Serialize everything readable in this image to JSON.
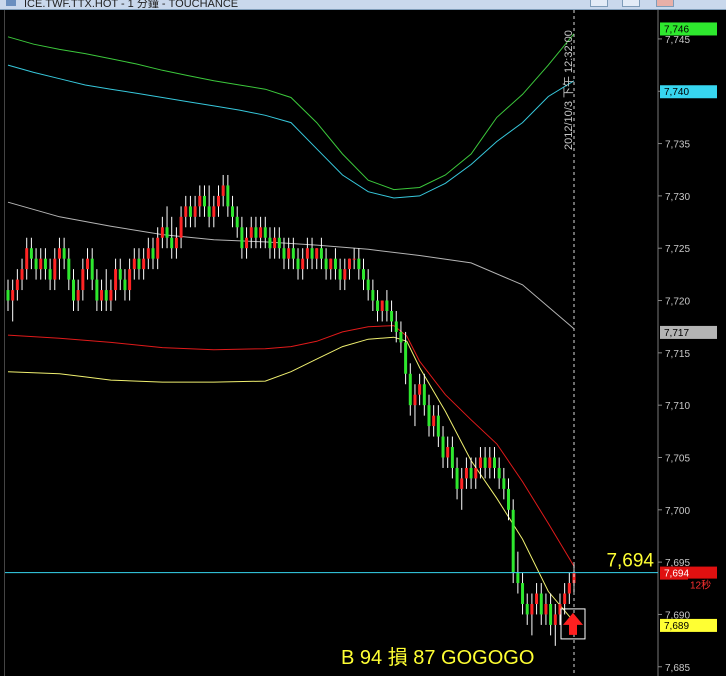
{
  "window": {
    "title": "ICE.TWF.TTX.HOT - 1 分鐘 - TOUCHANCE"
  },
  "chart_data": {
    "type": "candlestick",
    "y_ticks": [
      7685,
      7690,
      7695,
      7700,
      7705,
      7710,
      7715,
      7720,
      7725,
      7730,
      7735,
      7740,
      7745
    ],
    "y_tick_labels": [
      "7,685",
      "7,690",
      "7,695",
      "7,700",
      "7,705",
      "7,710",
      "7,715",
      "7,720",
      "7,725",
      "7,730",
      "7,735",
      "7,740",
      "7,745"
    ],
    "ylim": [
      7684.5,
      7747
    ],
    "cursor": {
      "datetime_label": "2012/10/3 下午 12:32:00",
      "price": 7694,
      "price_label": "7,694"
    },
    "price_tags": [
      {
        "label": "7,746",
        "value": 7746,
        "bg": "#2ee82e",
        "fg": "#000000"
      },
      {
        "label": "7,740",
        "value": 7740,
        "bg": "#37d6f0",
        "fg": "#000000"
      },
      {
        "label": "7,717",
        "value": 7717,
        "bg": "#b4b4b4",
        "fg": "#000000"
      },
      {
        "label": "7,694",
        "value": 7694,
        "bg": "#e01010",
        "fg": "#ffffff"
      },
      {
        "label": "7,689",
        "value": 7689,
        "bg": "#ffff33",
        "fg": "#000000"
      }
    ],
    "countdown_label": "12秒",
    "annotation": "B 94 損 87 GOGOGO",
    "signal": {
      "type": "buy-arrow",
      "price": 7689,
      "color": "#ff2020"
    },
    "overlays": [
      {
        "role": "upper-band-outer",
        "color": "#3cc83c",
        "points": [
          [
            0,
            7745.2
          ],
          [
            8,
            7744.5
          ],
          [
            16,
            7744
          ],
          [
            24,
            7743.6
          ],
          [
            32,
            7743.1
          ],
          [
            40,
            7742.6
          ],
          [
            48,
            7742
          ],
          [
            56,
            7741.5
          ],
          [
            64,
            7741
          ],
          [
            72,
            7740.6
          ],
          [
            80,
            7740.2
          ],
          [
            88,
            7739.4
          ],
          [
            96,
            7737
          ],
          [
            104,
            7734
          ],
          [
            112,
            7731.5
          ],
          [
            120,
            7730.6
          ],
          [
            128,
            7730.8
          ],
          [
            136,
            7732
          ],
          [
            144,
            7734
          ],
          [
            152,
            7737.5
          ],
          [
            160,
            7739.7
          ],
          [
            168,
            7742.5
          ],
          [
            176,
            7745.5
          ]
        ]
      },
      {
        "role": "upper-band-inner",
        "color": "#37c8dc",
        "points": [
          [
            0,
            7742.5
          ],
          [
            8,
            7741.8
          ],
          [
            16,
            7741.2
          ],
          [
            24,
            7740.6
          ],
          [
            32,
            7740.2
          ],
          [
            40,
            7739.8
          ],
          [
            48,
            7739.4
          ],
          [
            56,
            7739
          ],
          [
            64,
            7738.6
          ],
          [
            72,
            7738.2
          ],
          [
            80,
            7737.7
          ],
          [
            88,
            7737
          ],
          [
            96,
            7734.5
          ],
          [
            104,
            7732
          ],
          [
            112,
            7730.4
          ],
          [
            120,
            7729.8
          ],
          [
            128,
            7730
          ],
          [
            136,
            7731.2
          ],
          [
            144,
            7733
          ],
          [
            152,
            7735.2
          ],
          [
            160,
            7737
          ],
          [
            168,
            7739.5
          ],
          [
            176,
            7741
          ]
        ]
      },
      {
        "role": "long-moving-average",
        "color": "#b4b4b4",
        "points": [
          [
            0,
            7729.4
          ],
          [
            16,
            7728
          ],
          [
            32,
            7727.1
          ],
          [
            48,
            7726.3
          ],
          [
            64,
            7725.8
          ],
          [
            80,
            7725.6
          ],
          [
            96,
            7725.3
          ],
          [
            112,
            7724.9
          ],
          [
            128,
            7724.3
          ],
          [
            144,
            7723.6
          ],
          [
            160,
            7721.5
          ],
          [
            176,
            7717.3
          ]
        ]
      },
      {
        "role": "mid-average",
        "color": "#e01a1a",
        "points": [
          [
            0,
            7716.7
          ],
          [
            16,
            7716.4
          ],
          [
            32,
            7716
          ],
          [
            48,
            7715.5
          ],
          [
            64,
            7715.3
          ],
          [
            80,
            7715.4
          ],
          [
            88,
            7715.6
          ],
          [
            96,
            7716.1
          ],
          [
            104,
            7717
          ],
          [
            112,
            7717.5
          ],
          [
            120,
            7717.6
          ],
          [
            124,
            7716.6
          ],
          [
            128,
            7714.2
          ],
          [
            136,
            7711
          ],
          [
            144,
            7708.6
          ],
          [
            152,
            7706.3
          ],
          [
            160,
            7702.7
          ],
          [
            168,
            7698.7
          ],
          [
            176,
            7694.6
          ]
        ]
      },
      {
        "role": "fast-average",
        "color": "#f0f070",
        "points": [
          [
            0,
            7713.2
          ],
          [
            8,
            7713.1
          ],
          [
            16,
            7713
          ],
          [
            24,
            7712.7
          ],
          [
            32,
            7712.4
          ],
          [
            48,
            7712.2
          ],
          [
            64,
            7712.2
          ],
          [
            80,
            7712.3
          ],
          [
            88,
            7713.2
          ],
          [
            96,
            7714.4
          ],
          [
            104,
            7715.6
          ],
          [
            112,
            7716.3
          ],
          [
            120,
            7716.5
          ],
          [
            124,
            7716.1
          ],
          [
            128,
            7713.6
          ],
          [
            136,
            7709.4
          ],
          [
            144,
            7704.7
          ],
          [
            152,
            7701.1
          ],
          [
            160,
            7697.2
          ],
          [
            168,
            7692.2
          ],
          [
            176,
            7689.3
          ]
        ]
      }
    ],
    "candles": [
      [
        7721,
        7722,
        7719,
        7720
      ],
      [
        7720,
        7722,
        7718,
        7721
      ],
      [
        7721,
        7723,
        7720,
        7722
      ],
      [
        7722,
        7724,
        7721,
        7723
      ],
      [
        7723,
        7726,
        7722,
        7725
      ],
      [
        7725,
        7726,
        7723,
        7724
      ],
      [
        7724,
        7725,
        7722,
        7723
      ],
      [
        7723,
        7725,
        7722,
        7724
      ],
      [
        7724,
        7725,
        7722,
        7723
      ],
      [
        7723,
        7724,
        7721,
        7722
      ],
      [
        7722,
        7725,
        7721,
        7724
      ],
      [
        7724,
        7726,
        7722,
        7725
      ],
      [
        7725,
        7726,
        7723,
        7724
      ],
      [
        7724,
        7725,
        7721,
        7722
      ],
      [
        7722,
        7723,
        7719,
        7720
      ],
      [
        7720,
        7722,
        7719,
        7721
      ],
      [
        7721,
        7724,
        7720,
        7723
      ],
      [
        7723,
        7725,
        7722,
        7724
      ],
      [
        7724,
        7725,
        7721,
        7722
      ],
      [
        7722,
        7723,
        7719,
        7720
      ],
      [
        7720,
        7722,
        7719,
        7721
      ],
      [
        7721,
        7723,
        7719,
        7720
      ],
      [
        7720,
        7722,
        7719,
        7721
      ],
      [
        7721,
        7724,
        7720,
        7723
      ],
      [
        7723,
        7724,
        7721,
        7722
      ],
      [
        7722,
        7723,
        7720,
        7721
      ],
      [
        7721,
        7724,
        7720,
        7723
      ],
      [
        7723,
        7725,
        7722,
        7724
      ],
      [
        7724,
        7725,
        7722,
        7723
      ],
      [
        7723,
        7725,
        7722,
        7724
      ],
      [
        7724,
        7726,
        7723,
        7725
      ],
      [
        7725,
        7726,
        7723,
        7724
      ],
      [
        7724,
        7727,
        7723,
        7726
      ],
      [
        7726,
        7728,
        7725,
        7727
      ],
      [
        7727,
        7729,
        7725,
        7726
      ],
      [
        7726,
        7728,
        7724,
        7725
      ],
      [
        7725,
        7727,
        7724,
        7726
      ],
      [
        7726,
        7729,
        7725,
        7728
      ],
      [
        7728,
        7730,
        7727,
        7729
      ],
      [
        7729,
        7730,
        7727,
        7728
      ],
      [
        7728,
        7730,
        7727,
        7729
      ],
      [
        7729,
        7731,
        7728,
        7730
      ],
      [
        7730,
        7731,
        7728,
        7729
      ],
      [
        7729,
        7731,
        7727,
        7728
      ],
      [
        7728,
        7730,
        7727,
        7729
      ],
      [
        7729,
        7731,
        7728,
        7730
      ],
      [
        7730,
        7732,
        7729,
        7731
      ],
      [
        7731,
        7732,
        7728,
        7729
      ],
      [
        7729,
        7730,
        7727,
        7728
      ],
      [
        7728,
        7729,
        7726,
        7727
      ],
      [
        7727,
        7728,
        7724,
        7725
      ],
      [
        7725,
        7727,
        7724,
        7726
      ],
      [
        7726,
        7728,
        7725,
        7727
      ],
      [
        7727,
        7728,
        7725,
        7726
      ],
      [
        7726,
        7728,
        7725,
        7727
      ],
      [
        7727,
        7728,
        7725,
        7726
      ],
      [
        7726,
        7727,
        7724,
        7725
      ],
      [
        7725,
        7727,
        7724,
        7726
      ],
      [
        7726,
        7727,
        7724,
        7725
      ],
      [
        7725,
        7726,
        7723,
        7724
      ],
      [
        7724,
        7726,
        7723,
        7725
      ],
      [
        7725,
        7726,
        7723,
        7724
      ],
      [
        7724,
        7725,
        7722,
        7723
      ],
      [
        7723,
        7725,
        7722,
        7724
      ],
      [
        7724,
        7726,
        7723,
        7725
      ],
      [
        7725,
        7726,
        7723,
        7724
      ],
      [
        7724,
        7725,
        7723,
        7725
      ],
      [
        7725,
        7726,
        7723,
        7724
      ],
      [
        7724,
        7725,
        7722,
        7723
      ],
      [
        7723,
        7724,
        7722,
        7724
      ],
      [
        7724,
        7725,
        7722,
        7723
      ],
      [
        7723,
        7724,
        7721,
        7722
      ],
      [
        7722,
        7724,
        7721,
        7723
      ],
      [
        7723,
        7724,
        7722,
        7724
      ],
      [
        7724,
        7725,
        7723,
        7724
      ],
      [
        7724,
        7725,
        7722,
        7723
      ],
      [
        7723,
        7724,
        7721,
        7722
      ],
      [
        7722,
        7723,
        7720,
        7721
      ],
      [
        7721,
        7722,
        7719,
        7720
      ],
      [
        7720,
        7721,
        7718,
        7719
      ],
      [
        7719,
        7720,
        7718,
        7720
      ],
      [
        7720,
        7721,
        7718,
        7719
      ],
      [
        7719,
        7720,
        7717,
        7718
      ],
      [
        7718,
        7719,
        7716,
        7717
      ],
      [
        7717,
        7718,
        7715,
        7716
      ],
      [
        7716,
        7717,
        7712,
        7713
      ],
      [
        7713,
        7714,
        7709,
        7710
      ],
      [
        7710,
        7712,
        7708,
        7711
      ],
      [
        7711,
        7713,
        7710,
        7712
      ],
      [
        7712,
        7713,
        7709,
        7710
      ],
      [
        7710,
        7711,
        7707,
        7708
      ],
      [
        7708,
        7710,
        7707,
        7709
      ],
      [
        7709,
        7710,
        7706,
        7707
      ],
      [
        7707,
        7708,
        7704,
        7705
      ],
      [
        7705,
        7707,
        7704,
        7706
      ],
      [
        7706,
        7707,
        7703,
        7704
      ],
      [
        7704,
        7705,
        7701,
        7702
      ],
      [
        7702,
        7704,
        7700,
        7703
      ],
      [
        7703,
        7705,
        7702,
        7704
      ],
      [
        7704,
        7705,
        7702,
        7703
      ],
      [
        7703,
        7705,
        7702,
        7704
      ],
      [
        7704,
        7706,
        7703,
        7705
      ],
      [
        7705,
        7706,
        7703,
        7704
      ],
      [
        7704,
        7706,
        7703,
        7705
      ],
      [
        7705,
        7706,
        7703,
        7704
      ],
      [
        7704,
        7705,
        7702,
        7703
      ],
      [
        7703,
        7704,
        7701,
        7702
      ],
      [
        7702,
        7703,
        7699,
        7700
      ],
      [
        7700,
        7701,
        7693,
        7694
      ],
      [
        7694,
        7696,
        7692,
        7693
      ],
      [
        7693,
        7694,
        7690,
        7691
      ],
      [
        7691,
        7692,
        7689,
        7690
      ],
      [
        7690,
        7692,
        7688,
        7691
      ],
      [
        7691,
        7693,
        7690,
        7692
      ],
      [
        7692,
        7693,
        7689,
        7690
      ],
      [
        7690,
        7692,
        7689,
        7691
      ],
      [
        7691,
        7692,
        7688,
        7689
      ],
      [
        7689,
        7691,
        7687,
        7690
      ],
      [
        7690,
        7692,
        7689,
        7691
      ],
      [
        7691,
        7693,
        7690,
        7692
      ],
      [
        7692,
        7694,
        7691,
        7693
      ],
      [
        7693,
        7695,
        7692,
        7694
      ]
    ]
  }
}
